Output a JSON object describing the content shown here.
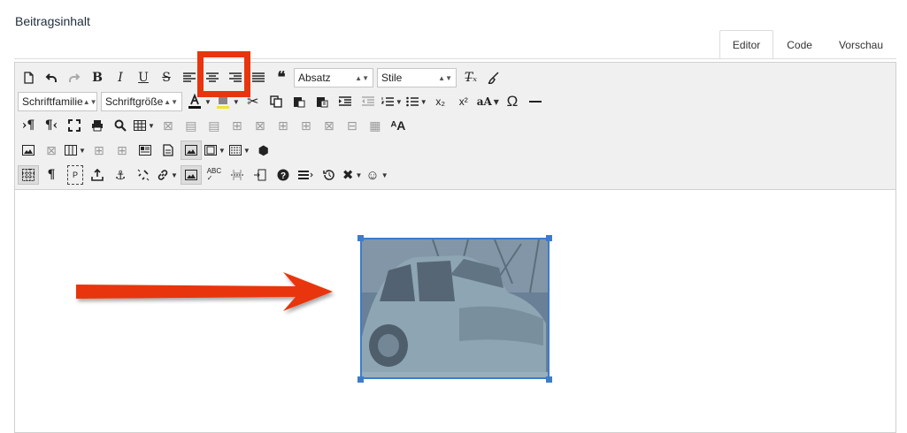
{
  "heading": "Beitragsinhalt",
  "tabs": [
    {
      "label": "Editor",
      "active": true
    },
    {
      "label": "Code",
      "active": false
    },
    {
      "label": "Vorschau",
      "active": false
    }
  ],
  "toolbar": {
    "paragraph_select": "Absatz",
    "style_select": "Stile",
    "font_family_select": "Schriftfamilie",
    "font_size_select": "Schriftgröße",
    "quote_glyph": "66",
    "bold_glyph": "B",
    "italic_glyph": "I",
    "underline_glyph": "U",
    "strike_glyph": "S",
    "omega_glyph": "Ω"
  },
  "colors": {
    "highlight_border": "#e8350f",
    "arrow": "#e8350f",
    "selection": "#3d7cc9",
    "toolbar_bg": "#f0f0f0"
  },
  "image": {
    "description_icon": "photo-car-icon"
  }
}
